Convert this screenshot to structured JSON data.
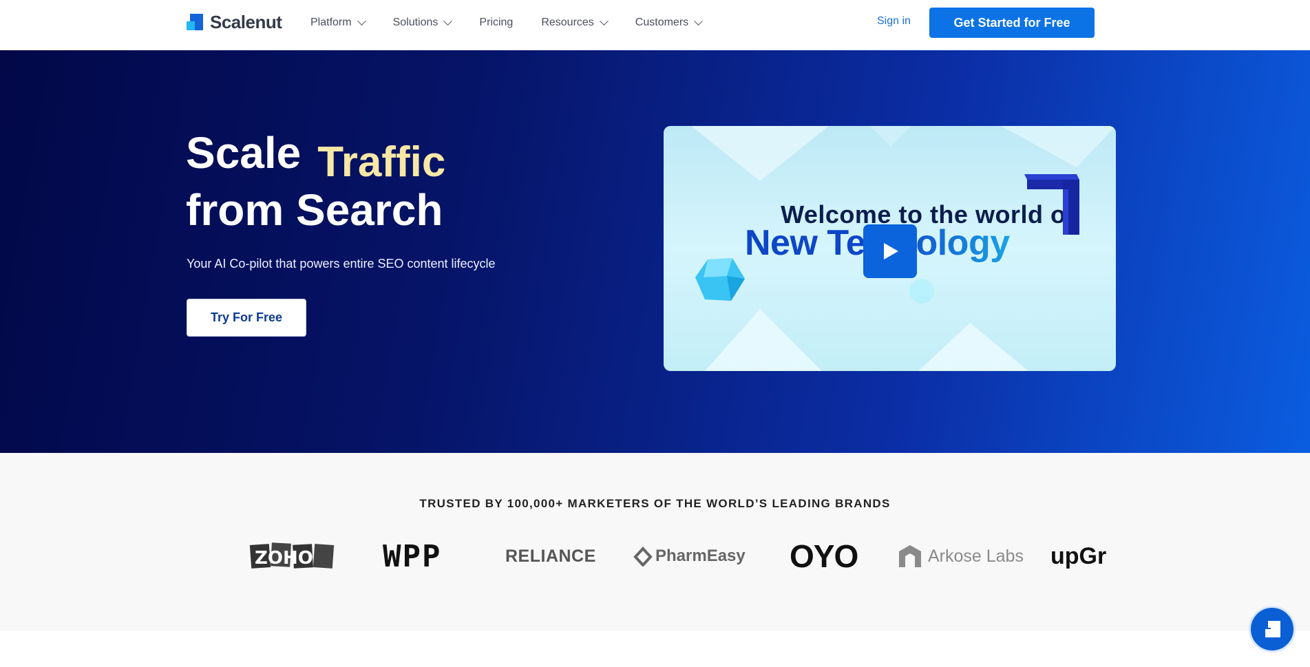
{
  "nav": {
    "logo_text": "Scalenut",
    "items": [
      {
        "label": "Platform",
        "dropdown": true
      },
      {
        "label": "Solutions",
        "dropdown": true
      },
      {
        "label": "Pricing",
        "dropdown": false
      },
      {
        "label": "Resources",
        "dropdown": true
      },
      {
        "label": "Customers",
        "dropdown": true
      }
    ],
    "signin_label": "Sign in",
    "cta_label": "Get Started for Free"
  },
  "hero": {
    "title_word1": "Scale",
    "title_highlight": "Traffic",
    "title_line2": "from Search",
    "subtitle": "Your AI Co-pilot that powers entire SEO content lifecycle",
    "button_label": "Try For Free",
    "video": {
      "line1": "Welcome to the world of",
      "line2_part1": "New Te",
      "line2_part2": "nology"
    }
  },
  "trusted": {
    "title": "TRUSTED BY 100,000+ MARKETERS OF THE WORLD’S LEADING BRANDS",
    "logos": [
      "ZOHO",
      "WPP",
      "RELIANCE",
      "PharmEasy",
      "OYO",
      "Arkose Labs",
      "upGr"
    ]
  },
  "colors": {
    "accent": "#0b73e6",
    "hero_dark": "#020848",
    "hero_light": "#0b5de0",
    "highlight": "#f7e7a6"
  }
}
